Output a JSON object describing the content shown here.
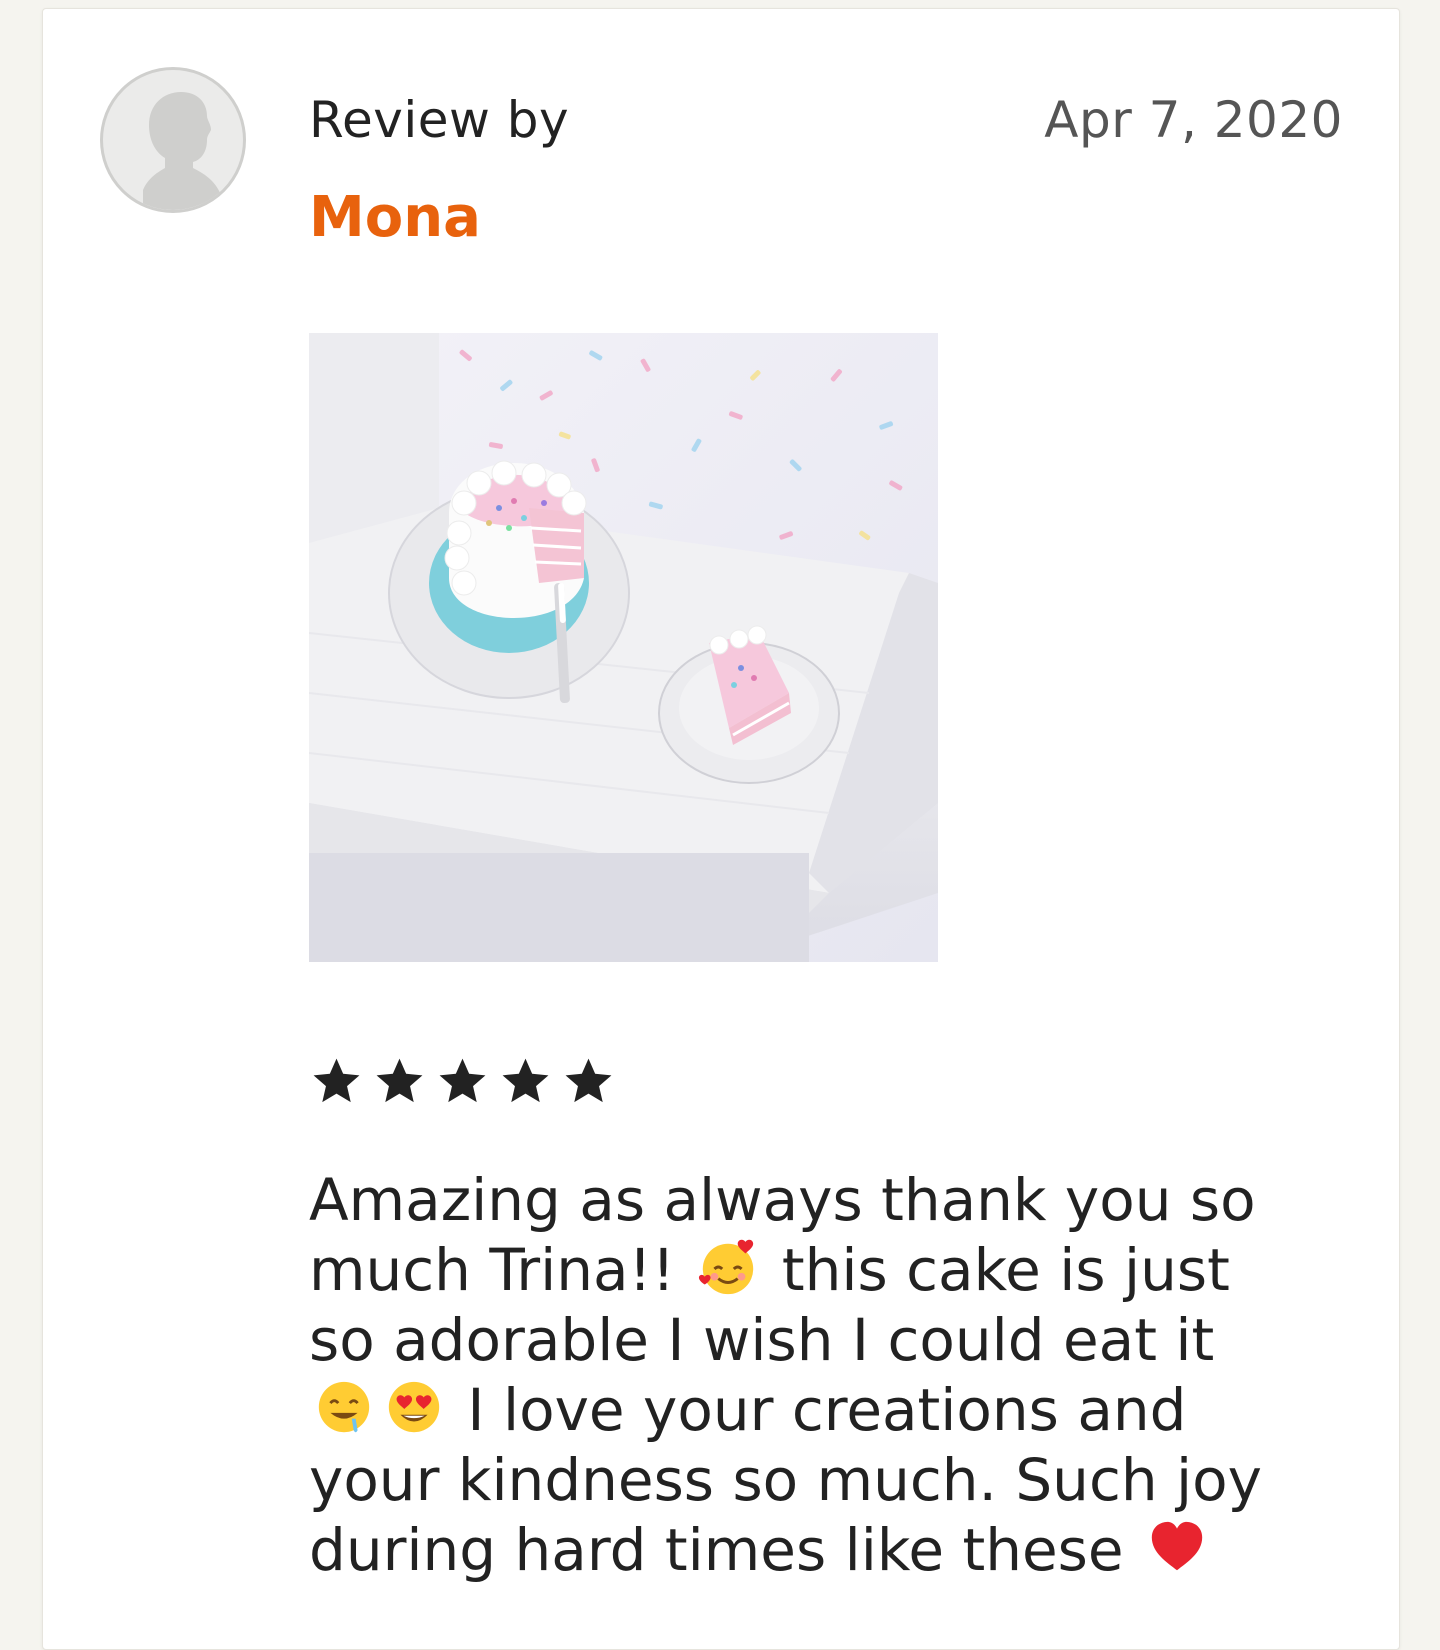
{
  "review": {
    "header_label": "Review by",
    "reviewer_name": "Mona",
    "date": "Apr 7, 2020",
    "rating": 5,
    "rating_max": 5,
    "text_parts": {
      "p1": "Amazing as always thank you so much Trina!! ",
      "p2": " this cake is just so adorable I wish I could eat it ",
      "p3": " I love your creations and your kindness so much. Such joy during hard times like these "
    },
    "emojis": [
      "smiling-face-with-hearts-icon",
      "drooling-face-icon",
      "heart-eyes-icon",
      "red-heart-icon"
    ],
    "photo_subject": "miniature pink layer cake with sprinkles on white tray"
  },
  "colors": {
    "accent": "#e8620d",
    "text": "#222222",
    "muted": "#555555",
    "background": "#f5f4ef",
    "card": "#ffffff"
  }
}
